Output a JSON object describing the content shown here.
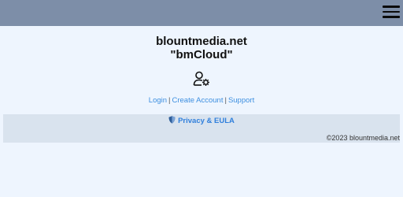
{
  "header": {
    "menu_icon": "hamburger-menu-icon",
    "bar_color": "#7d8ea8"
  },
  "main": {
    "title": "blountmedia.net",
    "subtitle": "\"bmCloud\"",
    "user_icon": "user-gear-icon",
    "links": {
      "login": "Login",
      "separator": "|",
      "create_account": "Create Account",
      "support": "Support"
    }
  },
  "footer": {
    "privacy_icon": "shield-icon",
    "privacy_label": "Privacy & EULA",
    "copyright": "©2023 blountmedia.net"
  },
  "colors": {
    "background": "#eef5fe",
    "footer_background": "#d9e3ee",
    "link": "#3d8fe0"
  }
}
